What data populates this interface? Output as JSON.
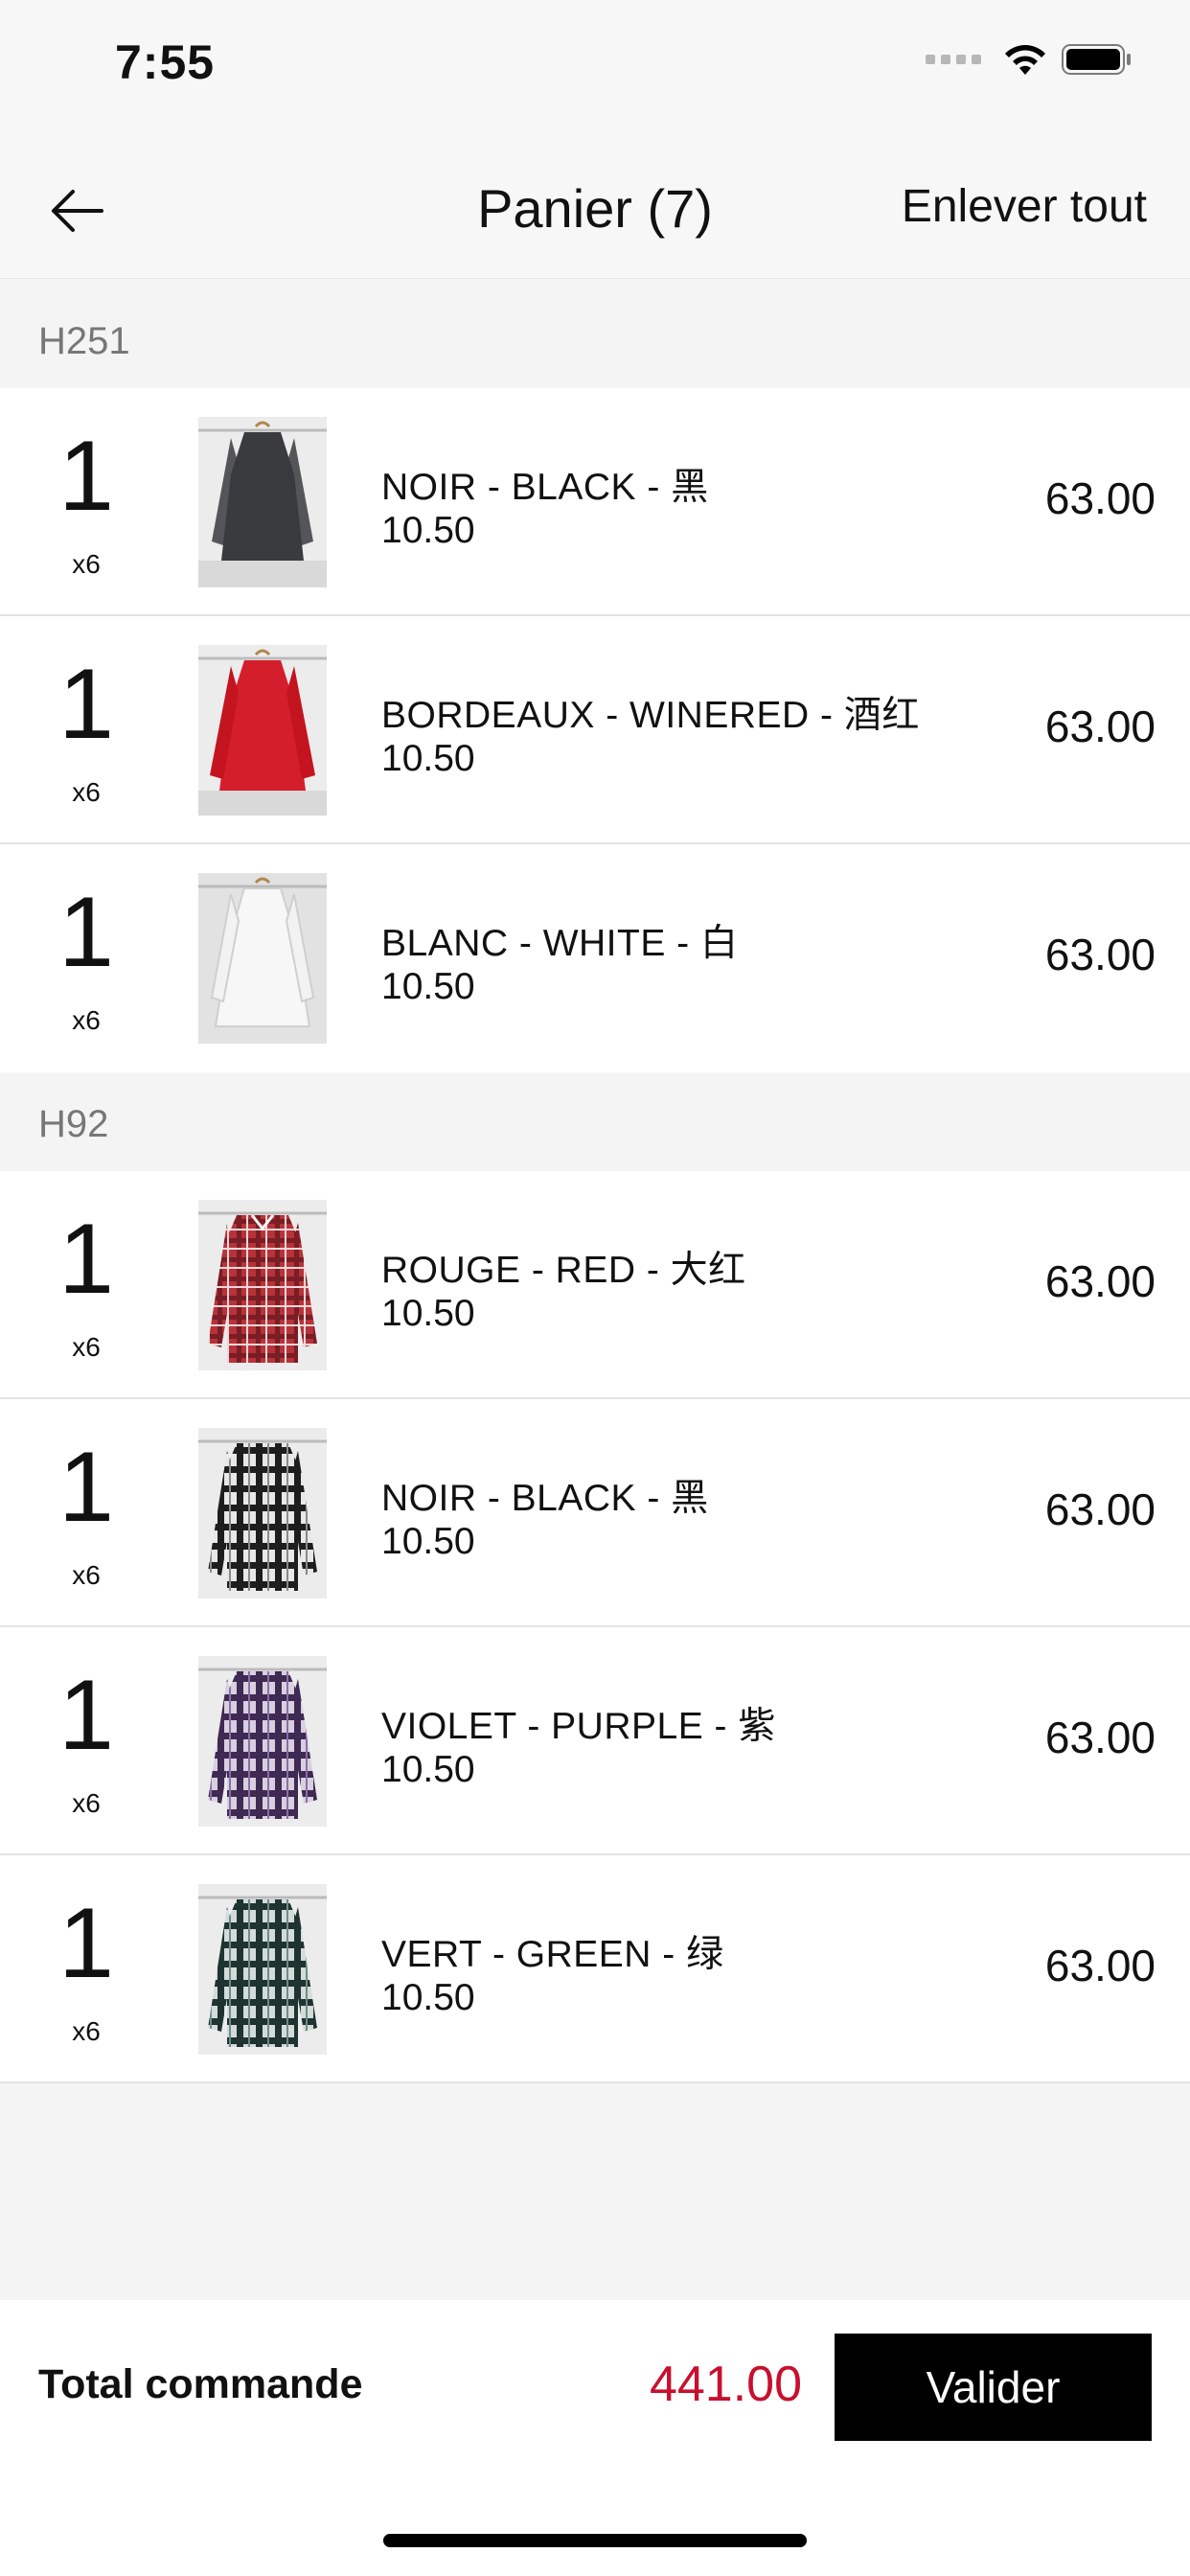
{
  "status_bar": {
    "time": "7:55"
  },
  "nav": {
    "title": "Panier (7)",
    "clear_label": "Enlever tout"
  },
  "sections": [
    {
      "label": "H251"
    },
    {
      "label": "H92"
    }
  ],
  "items": [
    {
      "qty": "1",
      "multiplier": "x6",
      "name": "NOIR - BLACK - 黑",
      "unit_price": "10.50",
      "total": "63.00",
      "thumb_color": "#3a3b3f"
    },
    {
      "qty": "1",
      "multiplier": "x6",
      "name": "BORDEAUX - WINERED - 酒红",
      "unit_price": "10.50",
      "total": "63.00",
      "thumb_color": "#d41e2c"
    },
    {
      "qty": "1",
      "multiplier": "x6",
      "name": "BLANC - WHITE - 白",
      "unit_price": "10.50",
      "total": "63.00",
      "thumb_color": "#eeeeee"
    },
    {
      "qty": "1",
      "multiplier": "x6",
      "name": "ROUGE - RED - 大红",
      "unit_price": "10.50",
      "total": "63.00",
      "thumb_color": "#b8323a"
    },
    {
      "qty": "1",
      "multiplier": "x6",
      "name": "NOIR - BLACK - 黑",
      "unit_price": "10.50",
      "total": "63.00",
      "thumb_color": "#2b2b2b"
    },
    {
      "qty": "1",
      "multiplier": "x6",
      "name": "VIOLET - PURPLE - 紫",
      "unit_price": "10.50",
      "total": "63.00",
      "thumb_color": "#5a3f6e"
    },
    {
      "qty": "1",
      "multiplier": "x6",
      "name": "VERT - GREEN - 绿",
      "unit_price": "10.50",
      "total": "63.00",
      "thumb_color": "#2f4a48"
    }
  ],
  "footer": {
    "total_label": "Total commande",
    "total_amount": "441.00",
    "validate_label": "Valider"
  },
  "colors": {
    "accent_total": "#c8102e",
    "button_bg": "#000000"
  }
}
